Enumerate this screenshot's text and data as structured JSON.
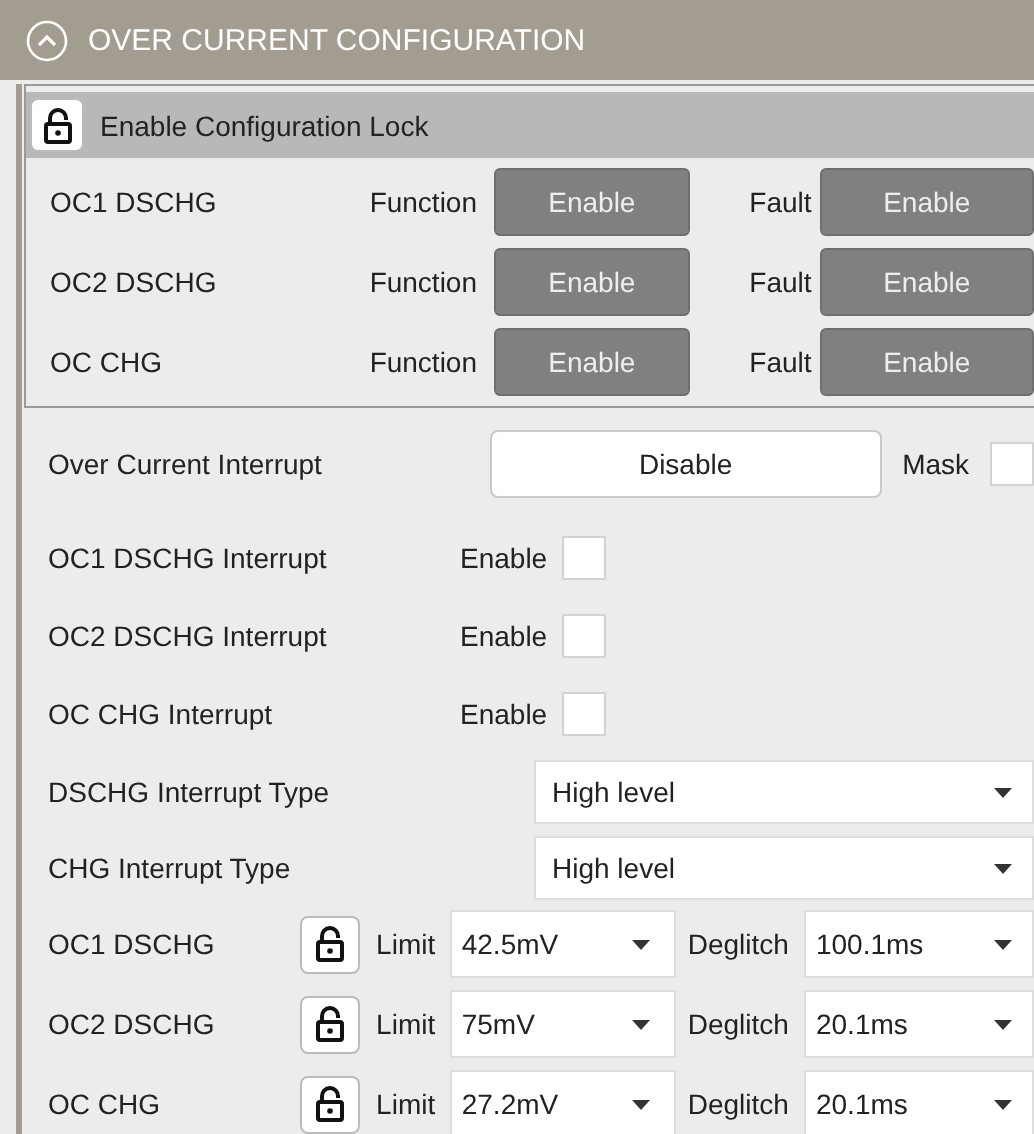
{
  "header": {
    "title": "OVER CURRENT CONFIGURATION",
    "expanded": true
  },
  "lock": {
    "label": "Enable Configuration Lock",
    "locked": false
  },
  "function_rows": [
    {
      "label": "OC1 DSCHG",
      "function_label": "Function",
      "function_value": "Enable",
      "fault_label": "Fault",
      "fault_value": "Enable"
    },
    {
      "label": "OC2 DSCHG",
      "function_label": "Function",
      "function_value": "Enable",
      "fault_label": "Fault",
      "fault_value": "Enable"
    },
    {
      "label": "OC CHG",
      "function_label": "Function",
      "function_value": "Enable",
      "fault_label": "Fault",
      "fault_value": "Enable"
    }
  ],
  "interrupt": {
    "label": "Over Current Interrupt",
    "value": "Disable",
    "mask_label": "Mask",
    "mask_checked": false
  },
  "interrupt_enables": [
    {
      "label": "OC1 DSCHG Interrupt",
      "enable_label": "Enable",
      "checked": false
    },
    {
      "label": "OC2 DSCHG Interrupt",
      "enable_label": "Enable",
      "checked": false
    },
    {
      "label": "OC CHG Interrupt",
      "enable_label": "Enable",
      "checked": false
    }
  ],
  "interrupt_types": [
    {
      "label": "DSCHG Interrupt Type",
      "value": "High level"
    },
    {
      "label": "CHG Interrupt Type",
      "value": "High level"
    }
  ],
  "thresholds": [
    {
      "label": "OC1 DSCHG",
      "locked": false,
      "limit_label": "Limit",
      "limit": "42.5mV",
      "deglitch_label": "Deglitch",
      "deglitch": "100.1ms"
    },
    {
      "label": "OC2 DSCHG",
      "locked": false,
      "limit_label": "Limit",
      "limit": "75mV",
      "deglitch_label": "Deglitch",
      "deglitch": "20.1ms"
    },
    {
      "label": "OC CHG",
      "locked": false,
      "limit_label": "Limit",
      "limit": "27.2mV",
      "deglitch_label": "Deglitch",
      "deglitch": "20.1ms"
    }
  ]
}
